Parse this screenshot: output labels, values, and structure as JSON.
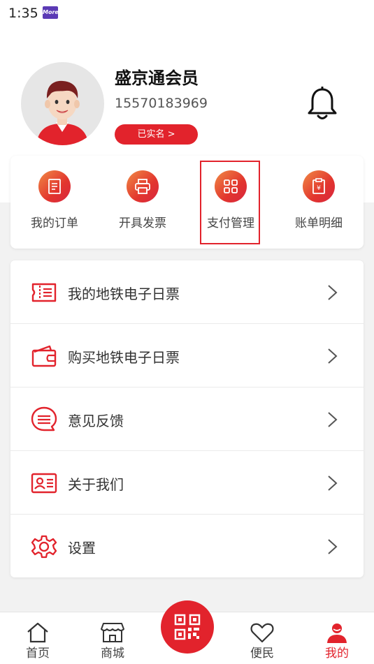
{
  "status_bar": {
    "time": "1:35",
    "app_badge": "More"
  },
  "profile": {
    "name": "盛京通会员",
    "phone": "15570183969",
    "verified_label": "已实名 >"
  },
  "quick_actions": [
    {
      "label": "我的订单",
      "icon": "order-icon"
    },
    {
      "label": "开具发票",
      "icon": "printer-icon"
    },
    {
      "label": "支付管理",
      "icon": "grid-icon"
    },
    {
      "label": "账单明细",
      "icon": "bill-icon"
    }
  ],
  "menu": [
    {
      "label": "我的地铁电子日票",
      "icon": "ticket-icon"
    },
    {
      "label": "购买地铁电子日票",
      "icon": "wallet-icon"
    },
    {
      "label": "意见反馈",
      "icon": "feedback-icon"
    },
    {
      "label": "关于我们",
      "icon": "id-card-icon"
    },
    {
      "label": "设置",
      "icon": "gear-icon"
    }
  ],
  "bottom_nav": [
    {
      "label": "首页",
      "icon": "home-icon"
    },
    {
      "label": "商城",
      "icon": "store-icon"
    },
    {
      "label": "便民",
      "icon": "heart-icon"
    },
    {
      "label": "我的",
      "icon": "person-icon",
      "active": true
    }
  ],
  "colors": {
    "accent": "#e2232c",
    "gradient_start": "#f08a45"
  }
}
